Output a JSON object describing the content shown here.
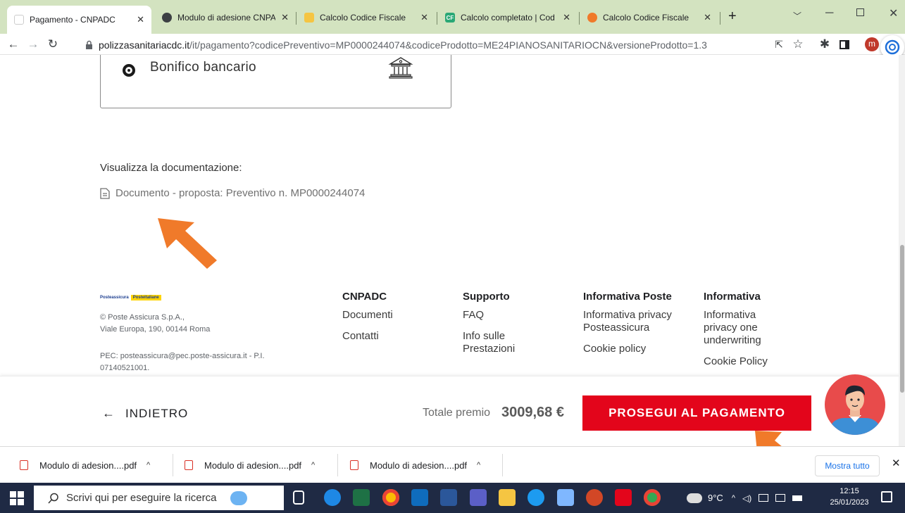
{
  "browser": {
    "tabs": [
      {
        "label": "Pagamento - CNPADC",
        "icon": "blank-page-icon",
        "active": true
      },
      {
        "label": "Modulo di adesione CNPA",
        "icon": "globe-icon"
      },
      {
        "label": "Calcolo Codice Fiscale",
        "icon": "calculator-icon"
      },
      {
        "label": "Calcolo completato | Cod",
        "icon": "cf-icon"
      },
      {
        "label": "Calcolo Codice Fiscale",
        "icon": "calculator-icon"
      }
    ],
    "new_tab": "+",
    "url_host": "polizzasanitariacdc.it",
    "url_rest": "/it/pagamento?codicePreventivo=MP0000244074&codiceProdotto=ME24PIANOSANITARIOCN&versioneProdotto=1.3",
    "profile_initial": "m"
  },
  "page": {
    "payment_option": "Bonifico bancario",
    "doc_heading": "Visualizza la documentazione:",
    "doc_link": "Documento - proposta: Preventivo n. MP0000244074",
    "logo_text": "Posteassicura",
    "logo_badge": "Posteitaliane",
    "company": "© Poste Assicura S.p.A.,",
    "address": "Viale Europa, 190, 00144 Roma",
    "pec1": "PEC: posteassicura@pec.poste-assicura.it - P.I.",
    "pec2": "07140521001.",
    "footer_cols": [
      {
        "heading": "CNPADC",
        "items": [
          "Documenti",
          "Contatti"
        ]
      },
      {
        "heading": "Supporto",
        "items": [
          "FAQ",
          "Info sulle Prestazioni"
        ]
      },
      {
        "heading": "Informativa Poste",
        "items": [
          "Informativa privacy Posteassicura",
          "Cookie policy"
        ]
      },
      {
        "heading": "Informativa",
        "items": [
          "Informativa privacy one underwriting",
          "Cookie Policy"
        ]
      }
    ],
    "back_label": "INDIETRO",
    "total_label": "Totale premio",
    "total_value": "3009,68 €",
    "pay_button": "PROSEGUI AL PAGAMENTO"
  },
  "downloads": {
    "items": [
      "Modulo di adesion....pdf",
      "Modulo di adesion....pdf",
      "Modulo di adesion....pdf"
    ],
    "show_all": "Mostra tutto"
  },
  "taskbar": {
    "search_placeholder": "Scrivi qui per eseguire la ricerca",
    "weather": "9°C",
    "time": "12:15",
    "date": "25/01/2023"
  },
  "colors": {
    "accent": "#e3051b",
    "arrow": "#f07a2a",
    "taskbar": "#1f2a44"
  }
}
